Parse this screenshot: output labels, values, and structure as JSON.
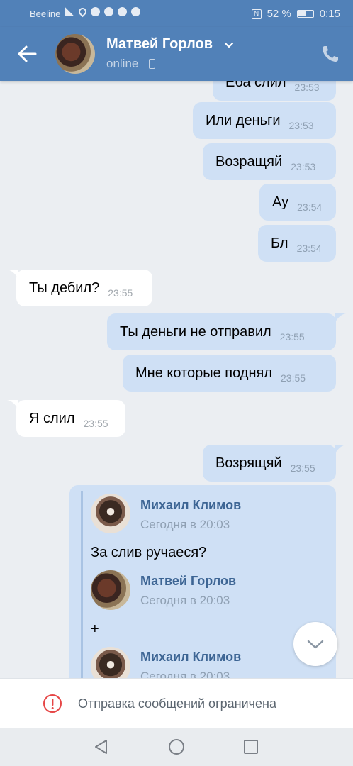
{
  "status_bar": {
    "carrier": "Beeline",
    "battery": "52 %",
    "time": "0:15"
  },
  "header": {
    "contact_name": "Матвей Горлов",
    "status": "online"
  },
  "messages": [
    {
      "text": "Еба слил",
      "time": "23:53",
      "dir": "out"
    },
    {
      "text": "Или деньги",
      "time": "23:53",
      "dir": "out"
    },
    {
      "text": "Возращяй",
      "time": "23:53",
      "dir": "out"
    },
    {
      "text": "Ау",
      "time": "23:54",
      "dir": "out"
    },
    {
      "text": "Бл",
      "time": "23:54",
      "dir": "out"
    },
    {
      "text": "Ты дебил?",
      "time": "23:55",
      "dir": "in"
    },
    {
      "text": "Ты деньги не отправил",
      "time": "23:55",
      "dir": "out"
    },
    {
      "text": "Мне которые поднял",
      "time": "23:55",
      "dir": "out"
    },
    {
      "text": "Я слил",
      "time": "23:55",
      "dir": "in"
    },
    {
      "text": "Возрящяй",
      "time": "23:55",
      "dir": "out"
    }
  ],
  "forwarded": [
    {
      "name": "Михаил Климов",
      "date": "Сегодня в 20:03",
      "text": "За слив ручаеся?"
    },
    {
      "name": "Матвей Горлов",
      "date": "Сегодня в 20:03",
      "text": "+"
    },
    {
      "name": "Михаил Климов",
      "date": "Сегодня в 20:03"
    }
  ],
  "restriction": {
    "text": "Отправка сообщений ограничена"
  }
}
